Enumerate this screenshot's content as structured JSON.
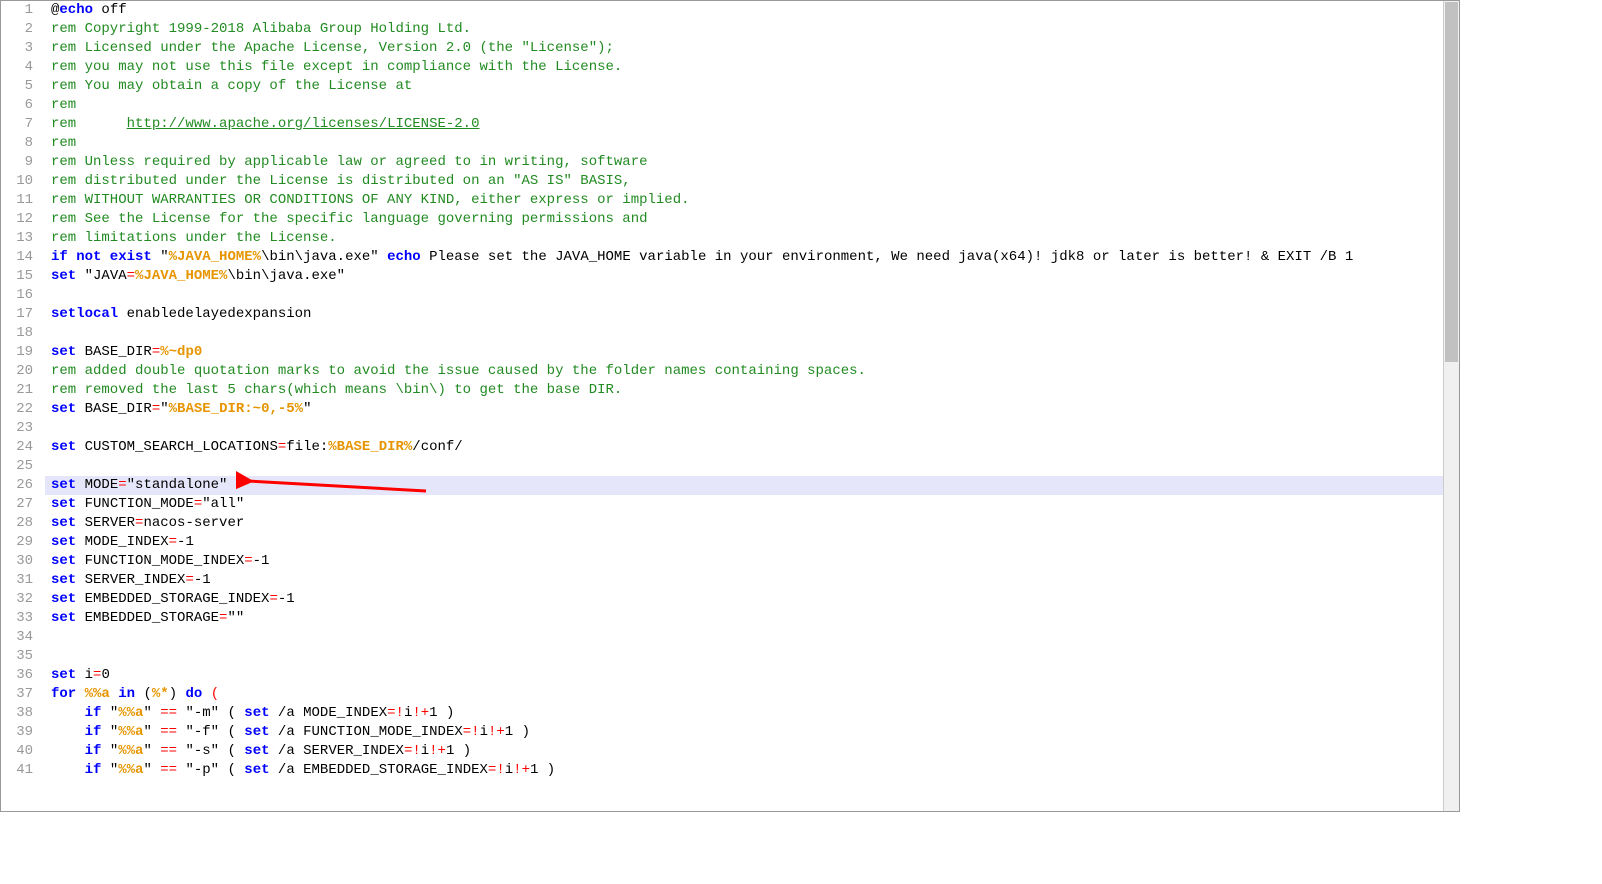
{
  "lines": [
    {
      "n": 1,
      "hl": false,
      "tokens": [
        [
          "txt",
          "@"
        ],
        [
          "kw",
          "echo"
        ],
        [
          "txt",
          " off"
        ]
      ]
    },
    {
      "n": 2,
      "hl": false,
      "tokens": [
        [
          "rem",
          "rem Copyright 1999-2018 Alibaba Group Holding Ltd."
        ]
      ]
    },
    {
      "n": 3,
      "hl": false,
      "tokens": [
        [
          "rem",
          "rem Licensed under the Apache License, Version 2.0 (the \"License\");"
        ]
      ]
    },
    {
      "n": 4,
      "hl": false,
      "tokens": [
        [
          "rem",
          "rem you may not use this file except in compliance with the License."
        ]
      ]
    },
    {
      "n": 5,
      "hl": false,
      "tokens": [
        [
          "rem",
          "rem You may obtain a copy of the License at"
        ]
      ]
    },
    {
      "n": 6,
      "hl": false,
      "tokens": [
        [
          "rem",
          "rem"
        ]
      ]
    },
    {
      "n": 7,
      "hl": false,
      "tokens": [
        [
          "rem",
          "rem      "
        ],
        [
          "link",
          "http://www.apache.org/licenses/LICENSE-2.0"
        ]
      ]
    },
    {
      "n": 8,
      "hl": false,
      "tokens": [
        [
          "rem",
          "rem"
        ]
      ]
    },
    {
      "n": 9,
      "hl": false,
      "tokens": [
        [
          "rem",
          "rem Unless required by applicable law or agreed to in writing, software"
        ]
      ]
    },
    {
      "n": 10,
      "hl": false,
      "tokens": [
        [
          "rem",
          "rem distributed under the License is distributed on an \"AS IS\" BASIS,"
        ]
      ]
    },
    {
      "n": 11,
      "hl": false,
      "tokens": [
        [
          "rem",
          "rem WITHOUT WARRANTIES OR CONDITIONS OF ANY KIND, either express or implied."
        ]
      ]
    },
    {
      "n": 12,
      "hl": false,
      "tokens": [
        [
          "rem",
          "rem See the License for the specific language governing permissions and"
        ]
      ]
    },
    {
      "n": 13,
      "hl": false,
      "tokens": [
        [
          "rem",
          "rem limitations under the License."
        ]
      ]
    },
    {
      "n": 14,
      "hl": false,
      "wrap": true,
      "tokens": [
        [
          "kw",
          "if not exist"
        ],
        [
          "txt",
          " \""
        ],
        [
          "var",
          "%JAVA_HOME%"
        ],
        [
          "txt",
          "\\bin\\java.exe\" "
        ],
        [
          "kw",
          "echo"
        ],
        [
          "txt",
          " Please set the JAVA_HOME variable in your environment, We need java(x64)! jdk8 or later is better! & EXIT /B 1"
        ]
      ]
    },
    {
      "n": 15,
      "hl": false,
      "tokens": [
        [
          "kw",
          "set"
        ],
        [
          "txt",
          " \"JAVA"
        ],
        [
          "op",
          "="
        ],
        [
          "var",
          "%JAVA_HOME%"
        ],
        [
          "txt",
          "\\bin\\java.exe\""
        ]
      ]
    },
    {
      "n": 16,
      "hl": false,
      "tokens": [
        [
          "txt",
          ""
        ]
      ]
    },
    {
      "n": 17,
      "hl": false,
      "tokens": [
        [
          "kw",
          "setlocal"
        ],
        [
          "txt",
          " enabledelayedexpansion"
        ]
      ]
    },
    {
      "n": 18,
      "hl": false,
      "tokens": [
        [
          "txt",
          ""
        ]
      ]
    },
    {
      "n": 19,
      "hl": false,
      "tokens": [
        [
          "kw",
          "set"
        ],
        [
          "txt",
          " BASE_DIR"
        ],
        [
          "op",
          "="
        ],
        [
          "var",
          "%~dp0"
        ]
      ]
    },
    {
      "n": 20,
      "hl": false,
      "tokens": [
        [
          "rem",
          "rem added double quotation marks to avoid the issue caused by the folder names containing spaces."
        ]
      ]
    },
    {
      "n": 21,
      "hl": false,
      "tokens": [
        [
          "rem",
          "rem removed the last 5 chars(which means \\bin\\) to get the base DIR."
        ]
      ]
    },
    {
      "n": 22,
      "hl": false,
      "tokens": [
        [
          "kw",
          "set"
        ],
        [
          "txt",
          " BASE_DIR"
        ],
        [
          "op",
          "="
        ],
        [
          "txt",
          "\""
        ],
        [
          "var",
          "%BASE_DIR:~0,-5%"
        ],
        [
          "txt",
          "\""
        ]
      ]
    },
    {
      "n": 23,
      "hl": false,
      "tokens": [
        [
          "txt",
          ""
        ]
      ]
    },
    {
      "n": 24,
      "hl": false,
      "tokens": [
        [
          "kw",
          "set"
        ],
        [
          "txt",
          " CUSTOM_SEARCH_LOCATIONS"
        ],
        [
          "op",
          "="
        ],
        [
          "txt",
          "file:"
        ],
        [
          "var",
          "%BASE_DIR%"
        ],
        [
          "txt",
          "/conf/"
        ]
      ]
    },
    {
      "n": 25,
      "hl": false,
      "tokens": [
        [
          "txt",
          ""
        ]
      ]
    },
    {
      "n": 26,
      "hl": true,
      "tokens": [
        [
          "kw",
          "set"
        ],
        [
          "txt",
          " MODE"
        ],
        [
          "op",
          "="
        ],
        [
          "txt",
          "\"standalone\""
        ]
      ]
    },
    {
      "n": 27,
      "hl": false,
      "tokens": [
        [
          "kw",
          "set"
        ],
        [
          "txt",
          " FUNCTION_MODE"
        ],
        [
          "op",
          "="
        ],
        [
          "txt",
          "\"all\""
        ]
      ]
    },
    {
      "n": 28,
      "hl": false,
      "tokens": [
        [
          "kw",
          "set"
        ],
        [
          "txt",
          " SERVER"
        ],
        [
          "op",
          "="
        ],
        [
          "txt",
          "nacos-server"
        ]
      ]
    },
    {
      "n": 29,
      "hl": false,
      "tokens": [
        [
          "kw",
          "set"
        ],
        [
          "txt",
          " MODE_INDEX"
        ],
        [
          "op",
          "="
        ],
        [
          "txt",
          "-1"
        ]
      ]
    },
    {
      "n": 30,
      "hl": false,
      "tokens": [
        [
          "kw",
          "set"
        ],
        [
          "txt",
          " FUNCTION_MODE_INDEX"
        ],
        [
          "op",
          "="
        ],
        [
          "txt",
          "-1"
        ]
      ]
    },
    {
      "n": 31,
      "hl": false,
      "tokens": [
        [
          "kw",
          "set"
        ],
        [
          "txt",
          " SERVER_INDEX"
        ],
        [
          "op",
          "="
        ],
        [
          "txt",
          "-1"
        ]
      ]
    },
    {
      "n": 32,
      "hl": false,
      "tokens": [
        [
          "kw",
          "set"
        ],
        [
          "txt",
          " EMBEDDED_STORAGE_INDEX"
        ],
        [
          "op",
          "="
        ],
        [
          "txt",
          "-1"
        ]
      ]
    },
    {
      "n": 33,
      "hl": false,
      "tokens": [
        [
          "kw",
          "set"
        ],
        [
          "txt",
          " EMBEDDED_STORAGE"
        ],
        [
          "op",
          "="
        ],
        [
          "txt",
          "\"\""
        ]
      ]
    },
    {
      "n": 34,
      "hl": false,
      "tokens": [
        [
          "txt",
          ""
        ]
      ]
    },
    {
      "n": 35,
      "hl": false,
      "tokens": [
        [
          "txt",
          ""
        ]
      ]
    },
    {
      "n": 36,
      "hl": false,
      "tokens": [
        [
          "kw",
          "set"
        ],
        [
          "txt",
          " i"
        ],
        [
          "op",
          "="
        ],
        [
          "txt",
          "0"
        ]
      ]
    },
    {
      "n": 37,
      "hl": false,
      "tokens": [
        [
          "kw",
          "for"
        ],
        [
          "txt",
          " "
        ],
        [
          "var",
          "%%a"
        ],
        [
          "txt",
          " "
        ],
        [
          "kw",
          "in"
        ],
        [
          "txt",
          " ("
        ],
        [
          "var",
          "%*"
        ],
        [
          "txt",
          ") "
        ],
        [
          "kw",
          "do"
        ],
        [
          "txt",
          " "
        ],
        [
          "op",
          "("
        ]
      ]
    },
    {
      "n": 38,
      "hl": false,
      "tokens": [
        [
          "txt",
          "    "
        ],
        [
          "kw",
          "if"
        ],
        [
          "txt",
          " \""
        ],
        [
          "var",
          "%%a"
        ],
        [
          "txt",
          "\" "
        ],
        [
          "op",
          "=="
        ],
        [
          "txt",
          " \"-m\" ( "
        ],
        [
          "kw",
          "set"
        ],
        [
          "txt",
          " /a MODE_INDEX"
        ],
        [
          "op",
          "=!"
        ],
        [
          "txt",
          "i"
        ],
        [
          "op",
          "!+"
        ],
        [
          "txt",
          "1 )"
        ]
      ]
    },
    {
      "n": 39,
      "hl": false,
      "tokens": [
        [
          "txt",
          "    "
        ],
        [
          "kw",
          "if"
        ],
        [
          "txt",
          " \""
        ],
        [
          "var",
          "%%a"
        ],
        [
          "txt",
          "\" "
        ],
        [
          "op",
          "=="
        ],
        [
          "txt",
          " \"-f\" ( "
        ],
        [
          "kw",
          "set"
        ],
        [
          "txt",
          " /a FUNCTION_MODE_INDEX"
        ],
        [
          "op",
          "=!"
        ],
        [
          "txt",
          "i"
        ],
        [
          "op",
          "!+"
        ],
        [
          "txt",
          "1 )"
        ]
      ]
    },
    {
      "n": 40,
      "hl": false,
      "tokens": [
        [
          "txt",
          "    "
        ],
        [
          "kw",
          "if"
        ],
        [
          "txt",
          " \""
        ],
        [
          "var",
          "%%a"
        ],
        [
          "txt",
          "\" "
        ],
        [
          "op",
          "=="
        ],
        [
          "txt",
          " \"-s\" ( "
        ],
        [
          "kw",
          "set"
        ],
        [
          "txt",
          " /a SERVER_INDEX"
        ],
        [
          "op",
          "=!"
        ],
        [
          "txt",
          "i"
        ],
        [
          "op",
          "!+"
        ],
        [
          "txt",
          "1 )"
        ]
      ]
    },
    {
      "n": 41,
      "hl": false,
      "tokens": [
        [
          "txt",
          "    "
        ],
        [
          "kw",
          "if"
        ],
        [
          "txt",
          " \""
        ],
        [
          "var",
          "%%a"
        ],
        [
          "txt",
          "\" "
        ],
        [
          "op",
          "=="
        ],
        [
          "txt",
          " \"-p\" ( "
        ],
        [
          "kw",
          "set"
        ],
        [
          "txt",
          " /a EMBEDDED_STORAGE_INDEX"
        ],
        [
          "op",
          "=!"
        ],
        [
          "txt",
          "i"
        ],
        [
          "op",
          "!+"
        ],
        [
          "txt",
          "1 )"
        ]
      ]
    }
  ],
  "annotation": {
    "arrow_color": "#ff0000",
    "target_line": 26
  }
}
